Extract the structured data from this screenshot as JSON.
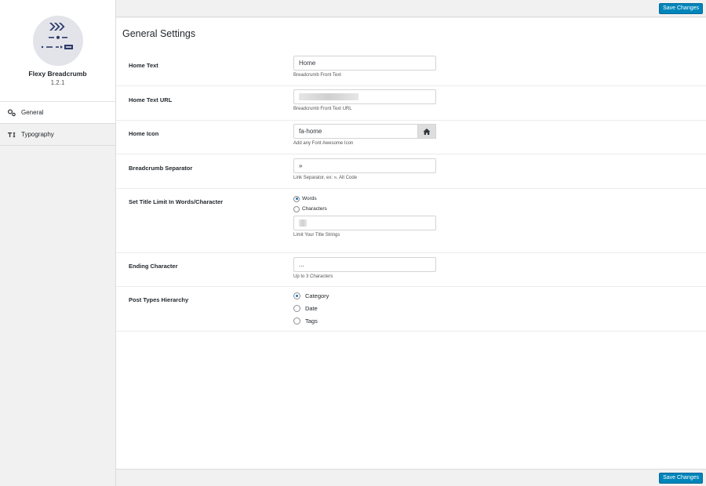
{
  "sidebar": {
    "brand_name": "Flexy Breadcrumb",
    "version": "1.2.1",
    "items": [
      {
        "label": "General",
        "icon": "gears-icon"
      },
      {
        "label": "Typography",
        "icon": "text-height-icon"
      }
    ]
  },
  "toolbar": {
    "save_label": "Save Changes"
  },
  "main": {
    "title": "General Settings",
    "home_text": {
      "label": "Home Text",
      "value": "Home",
      "desc": "Breadcrumb Front Text"
    },
    "home_url": {
      "label": "Home Text URL",
      "desc": "Breadcrumb Front Text URL"
    },
    "home_icon": {
      "label": "Home Icon",
      "value": "fa-home",
      "desc": "Add any Font Awesome Icon",
      "icon": "home-icon"
    },
    "separator": {
      "label": "Breadcrumb Separator",
      "value": "»",
      "desc": "Link Separator, ex: », Alt Code"
    },
    "title_limit": {
      "label": "Set Title Limit In Words/Character",
      "options": [
        {
          "label": "Words",
          "checked": true
        },
        {
          "label": "Characters",
          "checked": false
        }
      ],
      "desc": "Limit Your Title Strings"
    },
    "ending": {
      "label": "Ending Character",
      "value": "...",
      "desc": "Up to 3 Characters"
    },
    "post_types": {
      "label": "Post Types Hierarchy",
      "options": [
        {
          "label": "Category",
          "checked": true
        },
        {
          "label": "Date",
          "checked": false
        },
        {
          "label": "Tags",
          "checked": false
        }
      ]
    }
  },
  "colors": {
    "accent": "#0085ba",
    "radio_checked": "#2271b1",
    "logo_navy": "#2b3a67"
  }
}
